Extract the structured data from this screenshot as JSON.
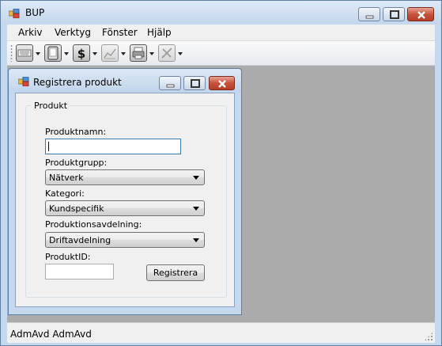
{
  "app": {
    "title": "BUP",
    "menu": [
      "Arkiv",
      "Verktyg",
      "Fönster",
      "Hjälp"
    ],
    "toolbar": [
      {
        "icon": "keyboard-icon"
      },
      {
        "icon": "tablet-icon"
      },
      {
        "icon": "dollar-icon"
      },
      {
        "icon": "chart-icon"
      },
      {
        "icon": "printer-icon"
      },
      {
        "icon": "tools-icon"
      }
    ],
    "status": "AdmAvd AdmAvd"
  },
  "child": {
    "title": "Registrera produkt",
    "group_title": "Produkt",
    "fields": {
      "name_label": "Produktnamn:",
      "name_value": "",
      "group_label": "Produktgrupp:",
      "group_value": "Nätverk",
      "category_label": "Kategori:",
      "category_value": "Kundspecifik",
      "dept_label": "Produktionsavdelning:",
      "dept_value": "Driftavdelning",
      "id_label": "ProduktID:",
      "id_value": ""
    },
    "submit_label": "Registrera"
  },
  "colors": {
    "frame": "#c5d9ee",
    "mdi_background": "#ababab",
    "close_button": "#c7523c"
  }
}
